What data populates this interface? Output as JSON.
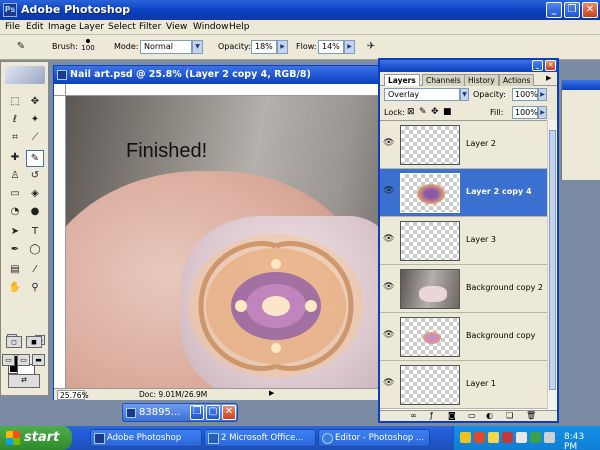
{
  "window": {
    "app_title": "Adobe Photoshop",
    "min_glyph": "_",
    "max_glyph": "❐",
    "close_glyph": "✕"
  },
  "menu": [
    "File",
    "Edit",
    "Image",
    "Layer",
    "Select",
    "Filter",
    "View",
    "Window",
    "Help"
  ],
  "options": {
    "brush_label": "Brush:",
    "brush_size": "100",
    "mode_label": "Mode:",
    "mode_value": "Normal",
    "opacity_label": "Opacity:",
    "opacity_value": "18%",
    "flow_label": "Flow:",
    "flow_value": "14%"
  },
  "document": {
    "title": "Nail art.psd @ 25.8% (Layer 2 copy 4, RGB/8)",
    "canvas_text": "Finished!",
    "zoom": "25.76%",
    "doc_info": "Doc: 9.01M/26.9M"
  },
  "minimized": {
    "title": "83895..."
  },
  "layers_panel": {
    "tabs": [
      "Layers",
      "Channels",
      "History",
      "Actions"
    ],
    "blend_mode": "Overlay",
    "opacity_label": "Opacity:",
    "opacity_value": "100%",
    "lock_label": "Lock:",
    "fill_label": "Fill:",
    "fill_value": "100%",
    "layers": [
      {
        "name": "Layer 2",
        "selected": false
      },
      {
        "name": "Layer 2 copy 4",
        "selected": true
      },
      {
        "name": "Layer 3",
        "selected": false
      },
      {
        "name": "Background copy 2",
        "selected": false
      },
      {
        "name": "Background copy",
        "selected": false
      },
      {
        "name": "Layer 1",
        "selected": false
      }
    ]
  },
  "taskbar": {
    "start_label": "start",
    "tasks": [
      "Adobe Photoshop",
      "2 Microsoft Office...",
      "Editor - Photoshop ..."
    ],
    "clock": "8:43 PM"
  }
}
